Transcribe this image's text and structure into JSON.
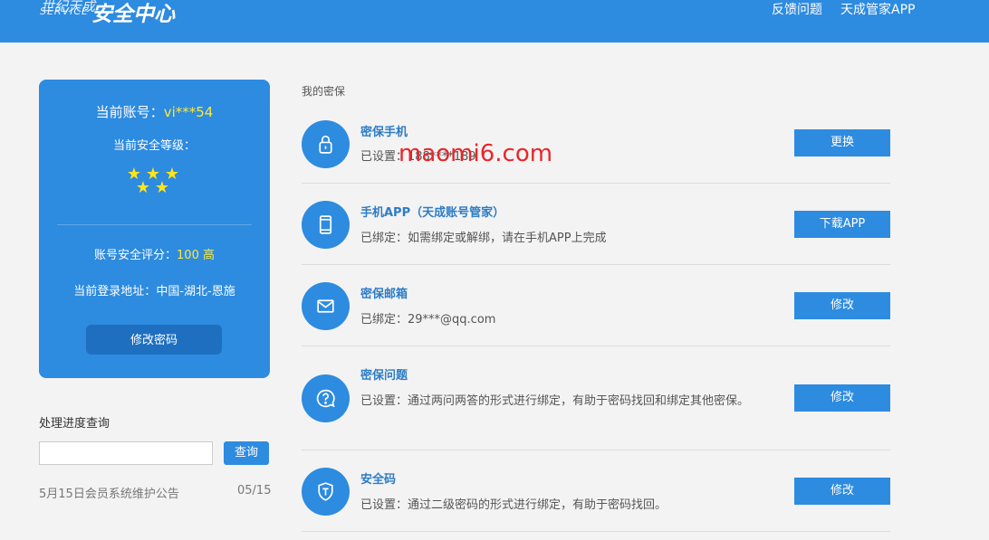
{
  "header": {
    "logo_top": "世纪天成",
    "logo_service": "SERVICE",
    "logo_main": "安全中心",
    "nav": [
      "反馈问题",
      "天成管家APP"
    ]
  },
  "account_card": {
    "account_label": "当前账号：",
    "account_value": "vi***54",
    "level_label": "当前安全等级：",
    "stars": 5,
    "score_label": "账号安全评分：",
    "score_value": "100 高",
    "location_label": "当前登录地址：",
    "location_value": "中国-湖北-恩施",
    "change_password_label": "修改密码"
  },
  "progress": {
    "title": "处理进度查询",
    "input_value": "",
    "query_label": "查询",
    "notice_text": "5月15日会员系统维护公告",
    "notice_date": "05/15"
  },
  "security": {
    "section_title": "我的密保",
    "items": [
      {
        "icon": "lock-icon",
        "name": "密保手机",
        "desc": "已设置：188****189",
        "button": "更换"
      },
      {
        "icon": "phone-icon",
        "name": "手机APP（天成账号管家）",
        "desc": "已绑定：如需绑定或解绑，请在手机APP上完成",
        "button": "下载APP"
      },
      {
        "icon": "mail-icon",
        "name": "密保邮箱",
        "desc": "已绑定：29***@qq.com",
        "button": "修改"
      },
      {
        "icon": "question-icon",
        "name": "密保问题",
        "desc": "已设置：通过两问两答的形式进行绑定，有助于密码找回和绑定其他密保。",
        "button": "修改"
      },
      {
        "icon": "shield-icon",
        "name": "安全码",
        "desc": "已设置：通过二级密码的形式进行绑定，有助于密码找回。",
        "button": "修改"
      }
    ]
  },
  "watermark": "maomi6.com",
  "colors": {
    "primary": "#2d8be0",
    "highlight": "#ffe83a",
    "watermark": "#e8262a"
  }
}
